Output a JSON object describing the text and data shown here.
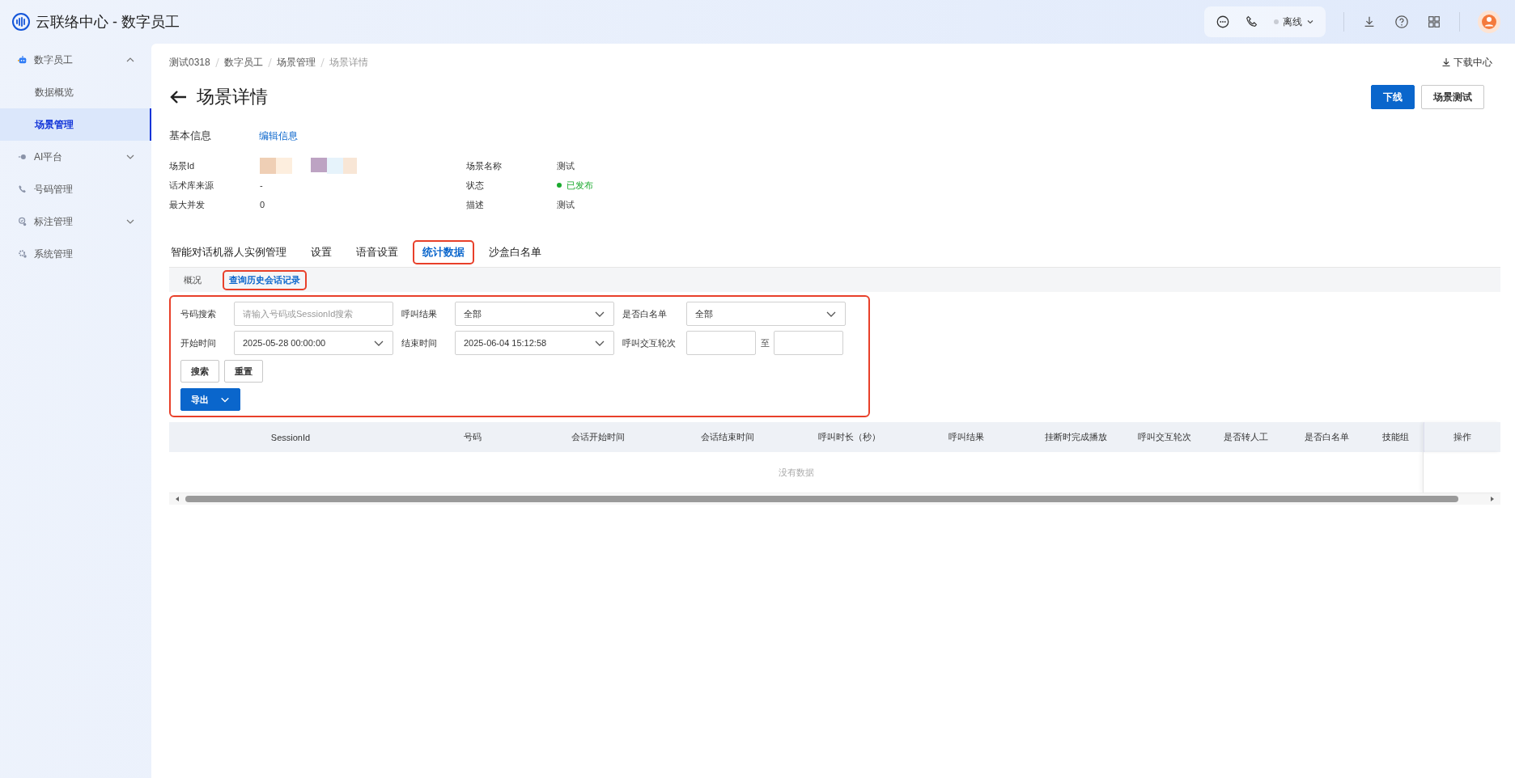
{
  "app": {
    "title": "云联络中心 - 数字员工"
  },
  "top_bar": {
    "status": {
      "label": "离线",
      "online": false
    }
  },
  "sidebar": {
    "items": [
      {
        "label": "数字员工",
        "selected": false,
        "expanded": true,
        "children": [
          {
            "label": "数据概览",
            "selected": false
          },
          {
            "label": "场景管理",
            "selected": true
          }
        ]
      },
      {
        "label": "AI平台",
        "selected": false,
        "expanded": false
      },
      {
        "label": "号码管理",
        "selected": false
      },
      {
        "label": "标注管理",
        "selected": false,
        "expanded": false
      },
      {
        "label": "系统管理",
        "selected": false
      }
    ]
  },
  "breadcrumb": [
    "测试0318",
    "数字员工",
    "场景管理",
    "场景详情"
  ],
  "download_center": "下载中心",
  "page": {
    "title": "场景详情",
    "buttons": [
      {
        "label": "下线",
        "primary": true
      },
      {
        "label": "场景测试",
        "primary": false
      }
    ]
  },
  "basic_info": {
    "heading": "基本信息",
    "edit_link": "编辑信息",
    "fields": [
      {
        "label": "场景Id",
        "kind": "redacted"
      },
      {
        "label": "场景名称",
        "kind": "text",
        "value": "测试"
      },
      {
        "label": "话术库来源",
        "kind": "text",
        "value": "-"
      },
      {
        "label": "状态",
        "kind": "status",
        "value": "已发布",
        "color": "#1aaa2e"
      },
      {
        "label": "最大并发",
        "kind": "text",
        "value": "0"
      },
      {
        "label": "描述",
        "kind": "text",
        "value": "测试"
      }
    ]
  },
  "tabs": [
    {
      "label": "智能对话机器人实例管理",
      "selected": false,
      "highlighted": false
    },
    {
      "label": "设置",
      "selected": false,
      "highlighted": false
    },
    {
      "label": "语音设置",
      "selected": false,
      "highlighted": false
    },
    {
      "label": "统计数据",
      "selected": true,
      "highlighted": true
    },
    {
      "label": "沙盒白名单",
      "selected": false,
      "highlighted": false
    }
  ],
  "subtabs": [
    {
      "label": "概况",
      "selected": false,
      "highlighted": false
    },
    {
      "label": "查询历史会话记录",
      "selected": true,
      "highlighted": true
    }
  ],
  "filters": {
    "highlighted": true,
    "fields": [
      {
        "label": "号码搜索",
        "kind": "input",
        "placeholder": "请输入号码或SessionId搜索"
      },
      {
        "label": "呼叫结果",
        "kind": "select",
        "value": "全部"
      },
      {
        "label": "是否白名单",
        "kind": "select",
        "value": "全部"
      },
      {
        "label": "开始时间",
        "kind": "select",
        "value": "2025-05-28 00:00:00"
      },
      {
        "label": "结束时间",
        "kind": "select",
        "value": "2025-06-04 15:12:58"
      },
      {
        "label": "呼叫交互轮次",
        "kind": "range",
        "separator": "至"
      }
    ],
    "buttons": [
      "搜索",
      "重置"
    ],
    "export_button": "导出"
  },
  "table": {
    "columns": [
      "SessionId",
      "号码",
      "会话开始时间",
      "会话结束时间",
      "呼叫时长（秒）",
      "呼叫结果",
      "挂断时完成播放",
      "呼叫交互轮次",
      "是否转人工",
      "是否白名单",
      "技能组",
      "操作"
    ],
    "empty_text": "没有数据"
  }
}
